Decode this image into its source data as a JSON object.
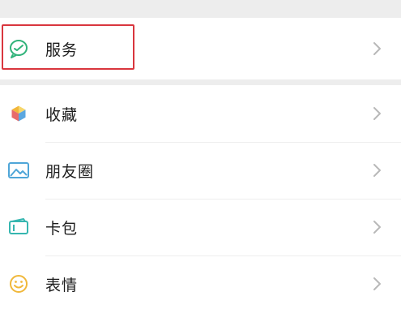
{
  "menu": {
    "groups": [
      {
        "items": [
          {
            "label": "服务",
            "icon": "wechat-pay-service-icon",
            "color": "#31b37a"
          }
        ]
      },
      {
        "items": [
          {
            "label": "收藏",
            "icon": "favorites-cube-icon",
            "color": "#f2b63a"
          },
          {
            "label": "朋友圈",
            "icon": "moments-photo-icon",
            "color": "#4fa6d8"
          },
          {
            "label": "卡包",
            "icon": "card-wallet-icon",
            "color": "#36b6b0"
          },
          {
            "label": "表情",
            "icon": "emoji-smile-icon",
            "color": "#f0b83b"
          }
        ]
      }
    ]
  },
  "highlight": {
    "color": "#d9363e",
    "target": "服务"
  },
  "colors": {
    "background": "#ededed",
    "surface": "#ffffff",
    "text": "#1d1d1d",
    "chevron": "#b8b8b8"
  }
}
